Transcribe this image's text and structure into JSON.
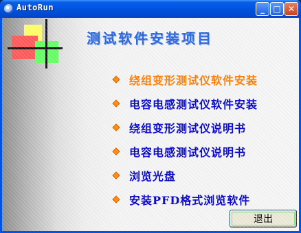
{
  "window": {
    "title": "AutoRun"
  },
  "heading": "测试软件安装项目",
  "menu": {
    "items": [
      {
        "label": "绕组变形测试仪软件安装",
        "active": true
      },
      {
        "label": "电容电感测试仪软件安装"
      },
      {
        "label": "绕组变形测试仪说明书"
      },
      {
        "label": "电容电感测试仪说明书"
      },
      {
        "label": "浏览光盘"
      },
      {
        "label": "安装PFD格式浏览软件"
      }
    ]
  },
  "exit_button": {
    "label": "退出"
  },
  "colors": {
    "heading": "#2a63d6",
    "menu_text": "#0000cc",
    "menu_active": "#ff7b00",
    "bullet": "#ff8c00",
    "titlebar": "#0054e3"
  },
  "icons": {
    "window": "autorun-cd-icon",
    "bullet": "diamond-bullet-icon"
  }
}
